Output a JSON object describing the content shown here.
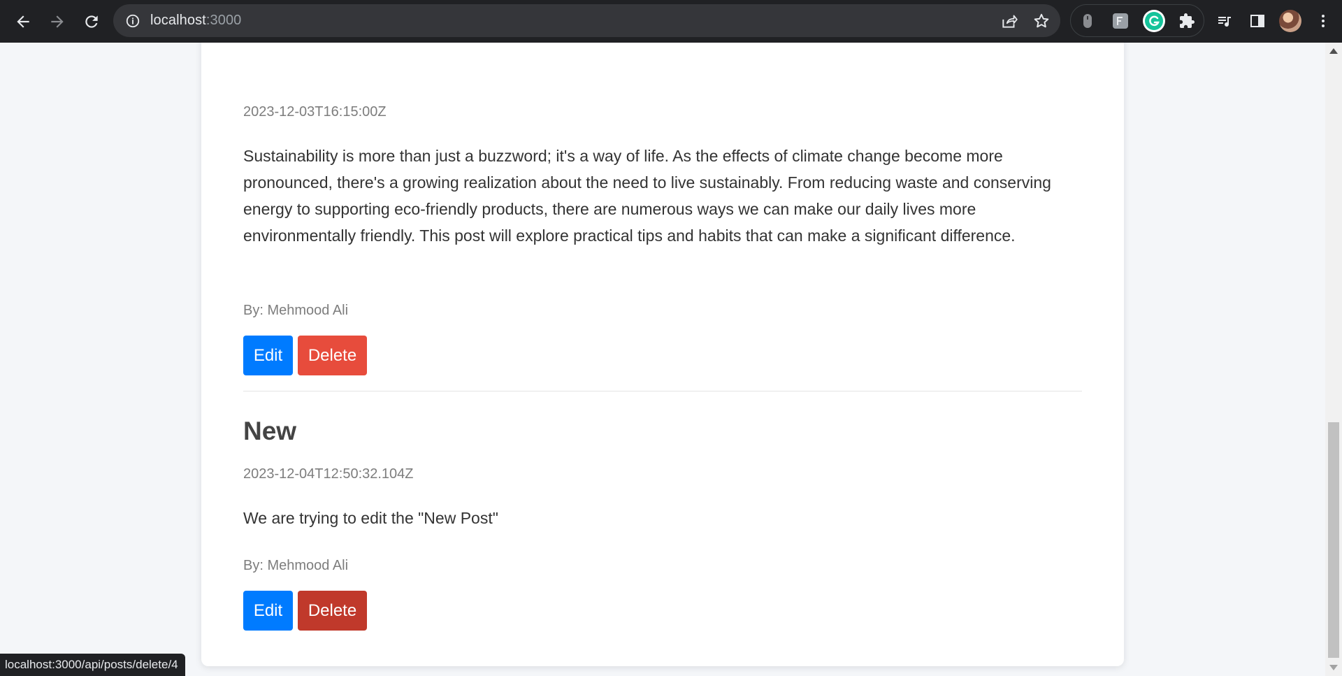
{
  "browser": {
    "url_host": "localhost",
    "url_port": ":3000",
    "status_url": "localhost:3000/api/posts/delete/4"
  },
  "posts": [
    {
      "date": "2023-12-03T16:15:00Z",
      "body": "Sustainability is more than just a buzzword; it's a way of life. As the effects of climate change become more pronounced, there's a growing realization about the need to live sustainably. From reducing waste and conserving energy to supporting eco-friendly products, there are numerous ways we can make our daily lives more environmentally friendly. This post will explore practical tips and habits that can make a significant difference.",
      "author": "By: Mehmood Ali",
      "edit_label": "Edit",
      "delete_label": "Delete"
    },
    {
      "title": "New",
      "date": "2023-12-04T12:50:32.104Z",
      "body": "We are trying to edit the \"New Post\"",
      "author": "By: Mehmood Ali",
      "edit_label": "Edit",
      "delete_label": "Delete"
    }
  ],
  "colors": {
    "edit_button": "#007bff",
    "delete_button": "#e74c3c",
    "delete_button_hover": "#c0392b"
  }
}
